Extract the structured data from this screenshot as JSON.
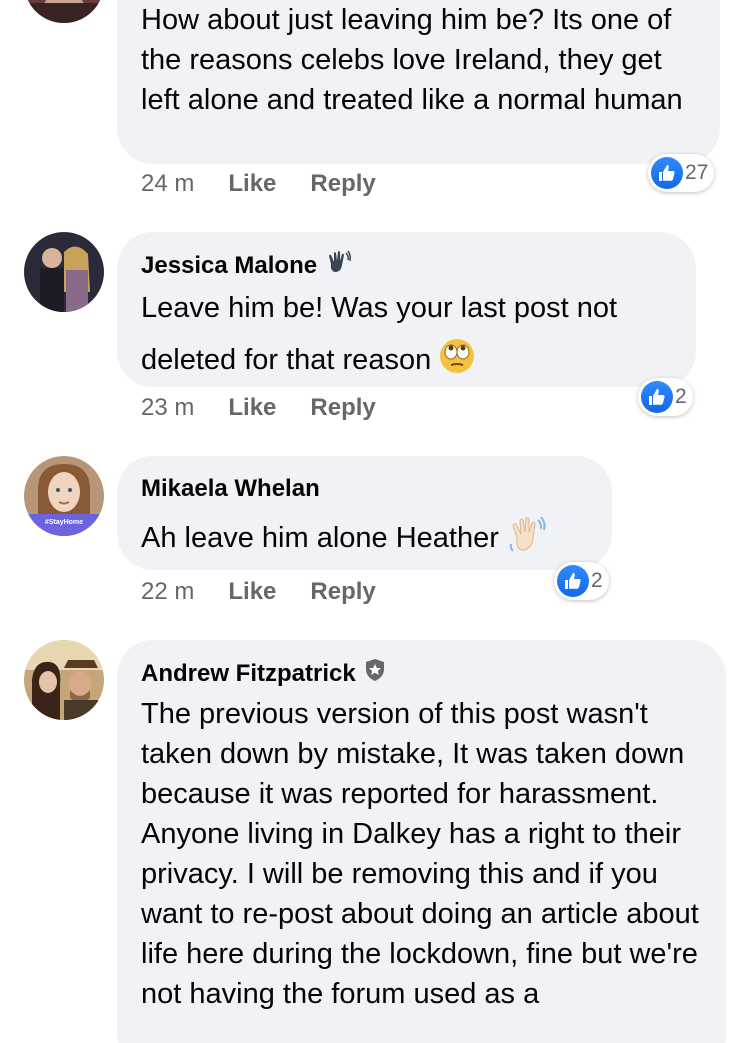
{
  "comments": [
    {
      "author": "",
      "text": "How about just leaving him be? Its one of the reasons celebs love Ireland, they get left alone and treated like a normal human",
      "time": "24 m",
      "like_label": "Like",
      "reply_label": "Reply",
      "reaction_count": "27"
    },
    {
      "author": "Jessica Malone",
      "author_badge": "waving-hand-icon",
      "text_line1": "Leave him be! Was your last post not",
      "text_line2": "deleted for that reason",
      "text_emoji": "eye-roll-emoji",
      "time": "23 m",
      "like_label": "Like",
      "reply_label": "Reply",
      "reaction_count": "2"
    },
    {
      "author": "Mikaela Whelan",
      "avatar_badge_text": "#StayHome",
      "text": "Ah leave him alone Heather",
      "text_emoji": "waving-hand-emoji",
      "time": "22 m",
      "like_label": "Like",
      "reply_label": "Reply",
      "reaction_count": "2"
    },
    {
      "author": "Andrew Fitzpatrick",
      "author_badge": "admin-shield-icon",
      "text": "The previous version of this post wasn't taken down by mistake,  It was taken down because it was reported for harassment.  Anyone living in Dalkey has a right to their privacy.  I will be removing this and if you want to re-post about doing an article about life here during the lockdown, fine but we're not having the forum used as a"
    }
  ],
  "colors": {
    "bubble": "#f0f2f5",
    "meta_text": "#65676b",
    "like_blue": "#1877f2"
  }
}
